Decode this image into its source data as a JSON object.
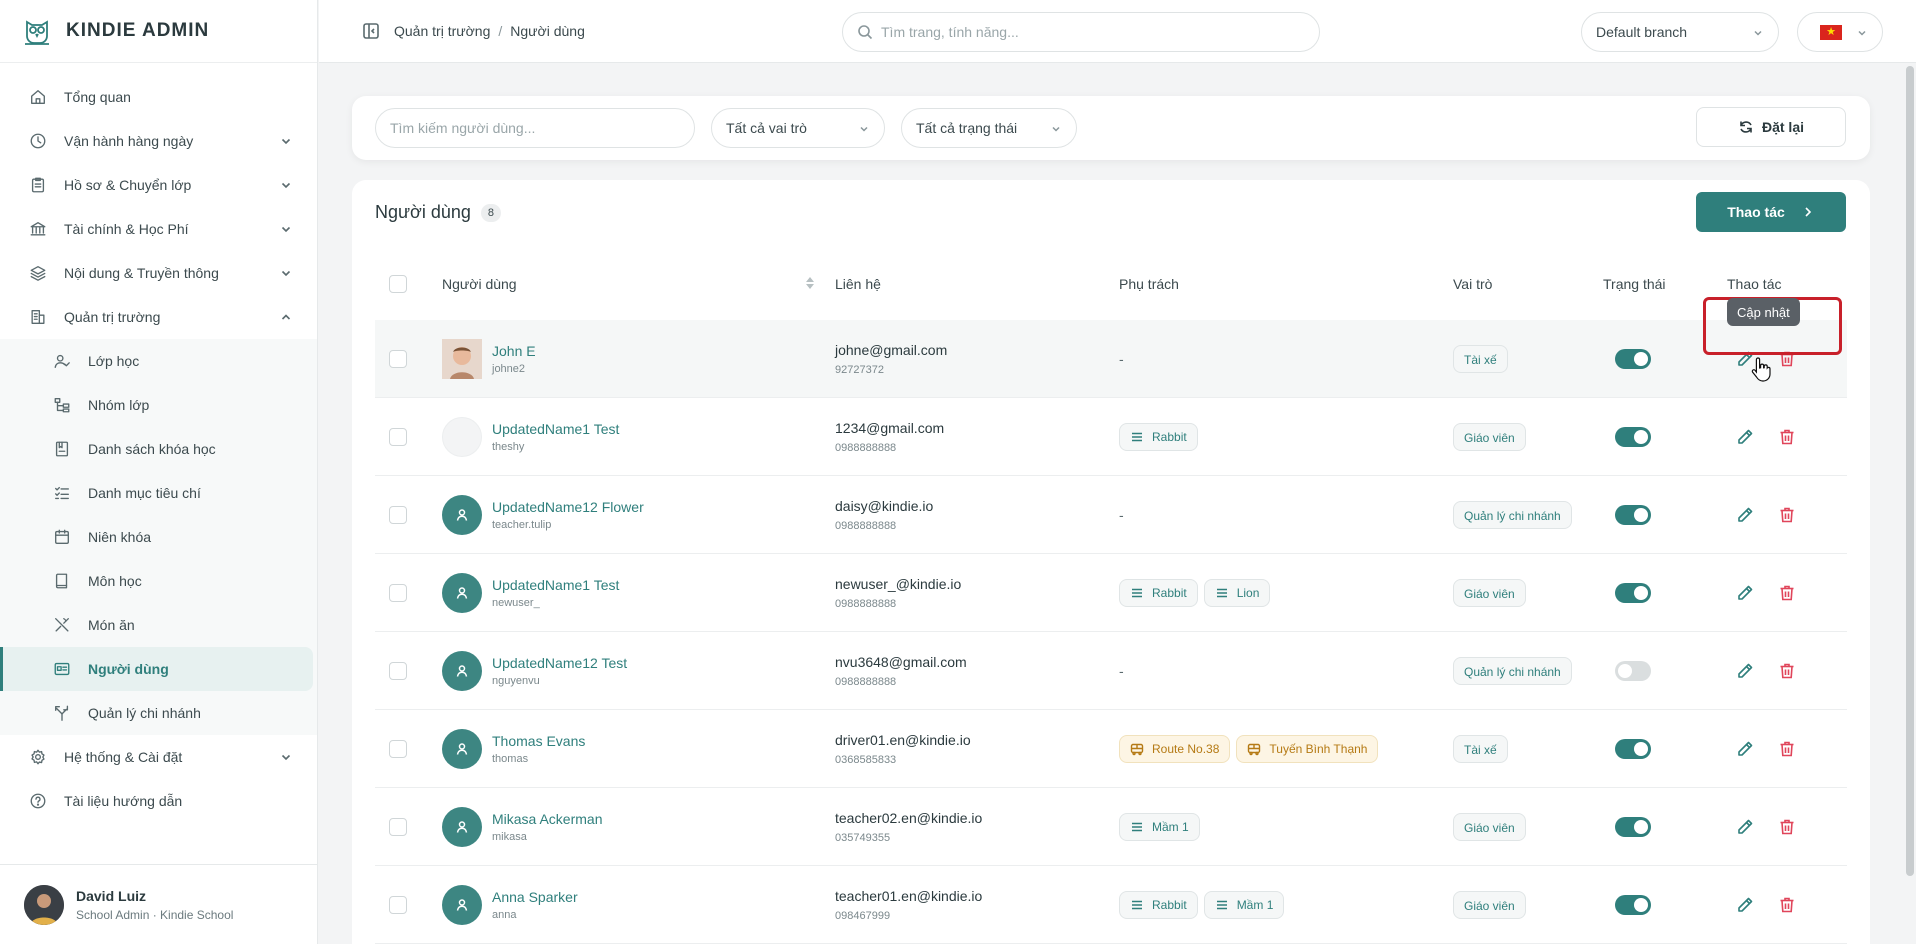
{
  "app": {
    "title": "KINDIE ADMIN"
  },
  "sidebar": {
    "items": [
      {
        "label": "Tổng quan",
        "icon": "home-icon"
      },
      {
        "label": "Vận hành hàng ngày",
        "icon": "clock-icon"
      },
      {
        "label": "Hồ sơ & Chuyển lớp",
        "icon": "clipboard-icon"
      },
      {
        "label": "Tài chính & Học Phí",
        "icon": "bank-icon"
      },
      {
        "label": "Nội dung & Truyền thông",
        "icon": "layers-icon"
      },
      {
        "label": "Quản trị trường",
        "icon": "building-icon"
      }
    ],
    "sub_items": [
      {
        "label": "Lớp học",
        "icon": "person-check-icon"
      },
      {
        "label": "Nhóm lớp",
        "icon": "tree-icon"
      },
      {
        "label": "Danh sách khóa học",
        "icon": "book-list-icon"
      },
      {
        "label": "Danh mục tiêu chí",
        "icon": "checklist-icon"
      },
      {
        "label": "Niên khóa",
        "icon": "calendar-icon"
      },
      {
        "label": "Môn học",
        "icon": "book-icon"
      },
      {
        "label": "Món ăn",
        "icon": "utensils-icon"
      },
      {
        "label": "Người dùng",
        "icon": "id-card-icon"
      },
      {
        "label": "Quản lý chi nhánh",
        "icon": "branch-icon"
      }
    ],
    "bottom_items": [
      {
        "label": "Hệ thống & Cài đặt",
        "icon": "gear-icon"
      },
      {
        "label": "Tài liệu hướng dẫn",
        "icon": "help-icon"
      }
    ],
    "user": {
      "name": "David Luiz",
      "role": "School Admin · Kindie School"
    }
  },
  "header": {
    "breadcrumb": [
      "Quản trị trường",
      "Người dùng"
    ],
    "search_placeholder": "Tìm trang, tính năng...",
    "branch": "Default branch"
  },
  "filters": {
    "search_placeholder": "Tìm kiếm người dùng...",
    "role": "Tất cả vai trò",
    "status": "Tất cả trạng thái",
    "reset": "Đặt lại"
  },
  "list": {
    "title": "Người dùng",
    "count": "8",
    "action_label": "Thao tác",
    "columns": {
      "user": "Người dùng",
      "contact": "Liên hệ",
      "responsible": "Phụ trách",
      "role": "Vai trò",
      "status": "Trạng thái",
      "actions": "Thao tác"
    },
    "tooltip": "Cập nhật",
    "rows": [
      {
        "name": "John E",
        "login": "johne2",
        "email": "johne@gmail.com",
        "phone": "92727372",
        "tags": [],
        "role": "Tài xế",
        "active": true
      },
      {
        "name": "UpdatedName1 Test",
        "login": "theshy",
        "email": "1234@gmail.com",
        "phone": "0988888888",
        "tags": [
          {
            "label": "Rabbit",
            "type": "class"
          }
        ],
        "role": "Giáo viên",
        "active": true
      },
      {
        "name": "UpdatedName12 Flower",
        "login": "teacher.tulip",
        "email": "daisy@kindie.io",
        "phone": "0988888888",
        "tags": [],
        "role": "Quản lý chi nhánh",
        "active": true
      },
      {
        "name": "UpdatedName1 Test",
        "login": "newuser_",
        "email": "newuser_@kindie.io",
        "phone": "0988888888",
        "tags": [
          {
            "label": "Rabbit",
            "type": "class"
          },
          {
            "label": "Lion",
            "type": "class"
          }
        ],
        "role": "Giáo viên",
        "active": true
      },
      {
        "name": "UpdatedName12 Test",
        "login": "nguyenvu",
        "email": "nvu3648@gmail.com",
        "phone": "0988888888",
        "tags": [],
        "role": "Quản lý chi nhánh",
        "active": false
      },
      {
        "name": "Thomas Evans",
        "login": "thomas",
        "email": "driver01.en@kindie.io",
        "phone": "0368585833",
        "tags": [
          {
            "label": "Route No.38",
            "type": "route"
          },
          {
            "label": "Tuyến Bình Thạnh",
            "type": "route"
          }
        ],
        "role": "Tài xế",
        "active": true
      },
      {
        "name": "Mikasa Ackerman",
        "login": "mikasa",
        "email": "teacher02.en@kindie.io",
        "phone": "035749355",
        "tags": [
          {
            "label": "Mầm 1",
            "type": "class"
          }
        ],
        "role": "Giáo viên",
        "active": true
      },
      {
        "name": "Anna Sparker",
        "login": "anna",
        "email": "teacher01.en@kindie.io",
        "phone": "098467999",
        "tags": [
          {
            "label": "Rabbit",
            "type": "class"
          },
          {
            "label": "Mầm 1",
            "type": "class"
          }
        ],
        "role": "Giáo viên",
        "active": true
      }
    ],
    "empty_placeholder": "-"
  }
}
